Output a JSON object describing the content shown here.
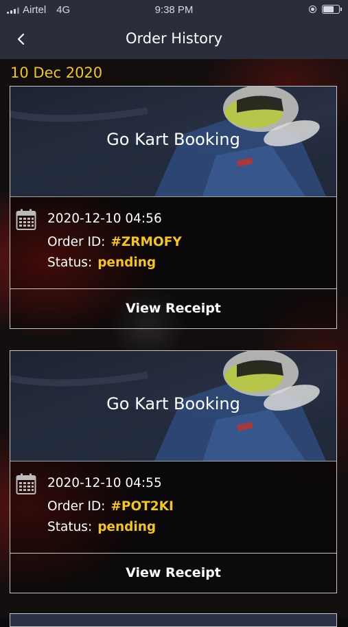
{
  "status_bar": {
    "carrier": "Airtel",
    "network": "4G",
    "time": "9:38 PM"
  },
  "header": {
    "title": "Order History",
    "back_icon": "chevron-left-icon"
  },
  "date_group": "10 Dec 2020",
  "orders": [
    {
      "title": "Go Kart Booking",
      "datetime": "2020-12-10 04:56",
      "order_id_label": "Order ID:",
      "order_id": "#ZRMOFY",
      "status_label": "Status:",
      "status": "pending",
      "action": "View Receipt"
    },
    {
      "title": "Go Kart Booking",
      "datetime": "2020-12-10 04:55",
      "order_id_label": "Order ID:",
      "order_id": "#POT2KI",
      "status_label": "Status:",
      "status": "pending",
      "action": "View Receipt"
    }
  ],
  "colors": {
    "accent": "#f2c330",
    "navbar": "#2b2e3a",
    "border": "#c7c7c7"
  }
}
